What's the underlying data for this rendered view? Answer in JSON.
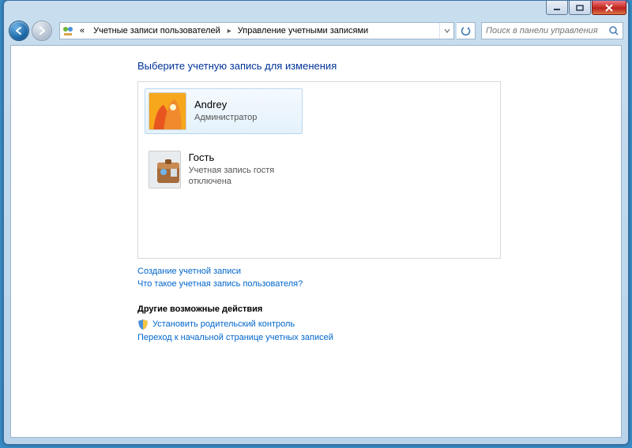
{
  "breadcrumb": {
    "back_chev": "«",
    "seg1": "Учетные записи пользователей",
    "seg2": "Управление учетными записями"
  },
  "search": {
    "placeholder": "Поиск в панели управления"
  },
  "page": {
    "heading": "Выберите учетную запись для изменения"
  },
  "accounts": {
    "andrey": {
      "name": "Andrey",
      "role": "Администратор"
    },
    "guest": {
      "name": "Гость",
      "role": "Учетная запись гостя отключена"
    }
  },
  "links": {
    "create": "Создание учетной записи",
    "whatis": "Что такое учетная запись пользователя?"
  },
  "other": {
    "title": "Другие возможные действия",
    "parental": "Установить родительский контроль",
    "goto": "Переход к начальной странице учетных записей"
  }
}
